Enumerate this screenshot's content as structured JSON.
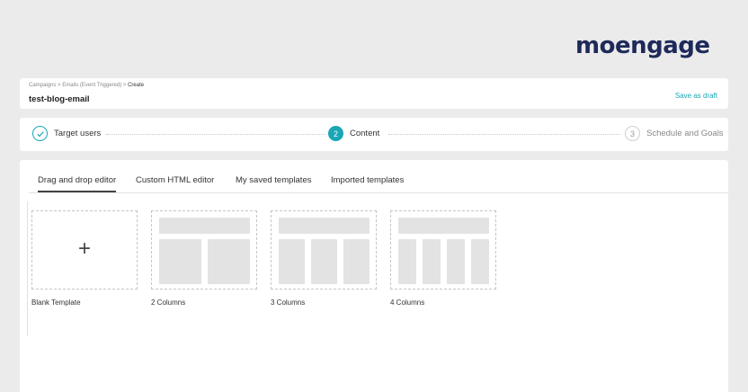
{
  "brand": {
    "logo_text": "moengage"
  },
  "header": {
    "breadcrumb": [
      "Campaigns",
      "Emails (Event Triggered)",
      "Create"
    ],
    "separator": " > ",
    "title": "test-blog-email",
    "save_draft_label": "Save as draft"
  },
  "steps": [
    {
      "number": "✓",
      "label": "Target users",
      "state": "done"
    },
    {
      "number": "2",
      "label": "Content",
      "state": "active"
    },
    {
      "number": "3",
      "label": "Schedule and Goals",
      "state": "pending"
    }
  ],
  "tabs": [
    {
      "label": "Drag and drop editor",
      "active": true
    },
    {
      "label": "Custom HTML editor",
      "active": false
    },
    {
      "label": "My saved templates",
      "active": false
    },
    {
      "label": "Imported templates",
      "active": false
    }
  ],
  "templates": [
    {
      "label": "Blank Template",
      "columns": 0
    },
    {
      "label": "2 Columns",
      "columns": 2
    },
    {
      "label": "3 Columns",
      "columns": 3
    },
    {
      "label": "4 Columns",
      "columns": 4
    }
  ],
  "colors": {
    "accent": "#1aa6b7",
    "logo": "#1e2a5a"
  }
}
